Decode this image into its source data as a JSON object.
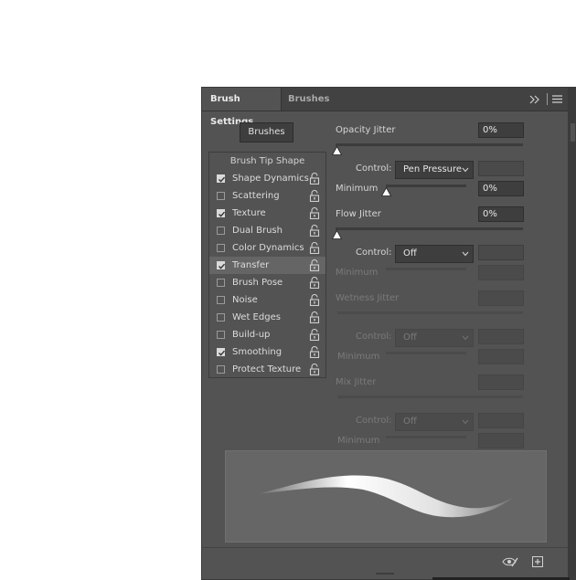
{
  "tabs": {
    "active": "Brush Settings",
    "inactive": "Brushes"
  },
  "brushes_button": "Brushes",
  "brush_tip_shape": "Brush Tip Shape",
  "options": [
    {
      "label": "Shape Dynamics",
      "checked": true,
      "selected": false
    },
    {
      "label": "Scattering",
      "checked": false,
      "selected": false
    },
    {
      "label": "Texture",
      "checked": true,
      "selected": false
    },
    {
      "label": "Dual Brush",
      "checked": false,
      "selected": false
    },
    {
      "label": "Color Dynamics",
      "checked": false,
      "selected": false
    },
    {
      "label": "Transfer",
      "checked": true,
      "selected": true
    },
    {
      "label": "Brush Pose",
      "checked": false,
      "selected": false
    },
    {
      "label": "Noise",
      "checked": false,
      "selected": false
    },
    {
      "label": "Wet Edges",
      "checked": false,
      "selected": false
    },
    {
      "label": "Build-up",
      "checked": false,
      "selected": false
    },
    {
      "label": "Smoothing",
      "checked": true,
      "selected": false
    },
    {
      "label": "Protect Texture",
      "checked": false,
      "selected": false
    }
  ],
  "opacity": {
    "label": "Opacity Jitter",
    "value": "0%",
    "slider_value": 0,
    "control_label": "Control:",
    "control_value": "Pen Pressure",
    "minimum_label": "Minimum",
    "minimum_value": "0%",
    "minimum_slider_value": 0
  },
  "flow": {
    "label": "Flow Jitter",
    "value": "0%",
    "slider_value": 0,
    "control_label": "Control:",
    "control_value": "Off",
    "minimum_label": "Minimum"
  },
  "wetness": {
    "label": "Wetness Jitter",
    "control_label": "Control:",
    "control_value": "Off",
    "minimum_label": "Minimum"
  },
  "mix": {
    "label": "Mix Jitter",
    "control_label": "Control:",
    "control_value": "Off",
    "minimum_label": "Minimum"
  },
  "colors": {
    "panel": "#535353",
    "tabbar": "#424242",
    "selected_row": "#656565",
    "preview": "#666666"
  },
  "icons": [
    "collapse-icon",
    "panel-menu-icon",
    "lock-icon",
    "checkbox-check-icon",
    "chevron-down-icon",
    "toggle-preview-icon",
    "new-preset-icon"
  ]
}
